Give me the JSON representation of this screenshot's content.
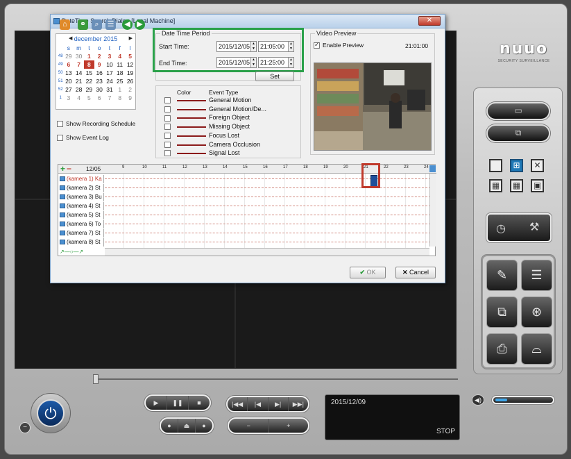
{
  "dialog": {
    "title": "DateTime Search Dialog [Local Machine]",
    "close_glyph": "✕"
  },
  "calendar": {
    "month_label": "december 2015",
    "prev_glyph": "◀",
    "next_glyph": "▶",
    "weekday_headers": [
      "s",
      "m",
      "t",
      "o",
      "t",
      "f",
      "l"
    ],
    "weeks": [
      {
        "wk": "48",
        "days": [
          "29",
          "30",
          "1",
          "2",
          "3",
          "4",
          "5"
        ]
      },
      {
        "wk": "49",
        "days": [
          "6",
          "7",
          "8",
          "9",
          "10",
          "11",
          "12"
        ]
      },
      {
        "wk": "50",
        "days": [
          "13",
          "14",
          "15",
          "16",
          "17",
          "18",
          "19"
        ]
      },
      {
        "wk": "51",
        "days": [
          "20",
          "21",
          "22",
          "23",
          "24",
          "25",
          "26"
        ]
      },
      {
        "wk": "52",
        "days": [
          "27",
          "28",
          "29",
          "30",
          "31",
          "1",
          "2"
        ]
      },
      {
        "wk": "1",
        "days": [
          "3",
          "4",
          "5",
          "6",
          "7",
          "8",
          "9"
        ]
      }
    ]
  },
  "options": {
    "show_recording_schedule": "Show Recording Schedule",
    "show_event_log": "Show Event Log"
  },
  "period": {
    "group_label": "Date Time Period",
    "start_label": "Start Time:",
    "start_date": "2015/12/05",
    "start_time": "21:05:00",
    "end_label": "End Time:",
    "end_date": "2015/12/05",
    "end_time": "21:25:00",
    "set_label": "Set"
  },
  "events": {
    "color_header": "Color",
    "type_header": "Event Type",
    "items": [
      "General Motion",
      "General Motion/De...",
      "Foreign Object",
      "Missing Object",
      "Focus Lost",
      "Camera Occlusion",
      "Signal Lost"
    ],
    "line_color": "#8b1a1a"
  },
  "preview": {
    "group_label": "Video Preview",
    "enable_label": "Enable Preview",
    "time": "21:01:00"
  },
  "timeline": {
    "date_label": "12/05",
    "hours": [
      "9",
      "10",
      "11",
      "12",
      "13",
      "14",
      "15",
      "16",
      "17",
      "18",
      "19",
      "20",
      "21",
      "22",
      "23",
      "24"
    ],
    "cameras": [
      "(kamera 1) Ka",
      "(kamera 2) St",
      "(kamera 3) Bu",
      "(kamera 4) St",
      "(kamera 5) St",
      "(kamera 6) To",
      "(kamera 7) St",
      "(kamera 8) St"
    ]
  },
  "buttons": {
    "ok": "OK",
    "cancel": "Cancel"
  },
  "brand": {
    "logo": "nuuo",
    "tagline": "SECURITY SURVEILLANCE"
  },
  "player": {
    "date": "2015/12/09",
    "state": "STOP",
    "volume_level": 0.2
  },
  "colors": {
    "highlight_green": "#2aa14a",
    "highlight_red": "#c0392b",
    "accent_blue": "#1f7ab8"
  }
}
